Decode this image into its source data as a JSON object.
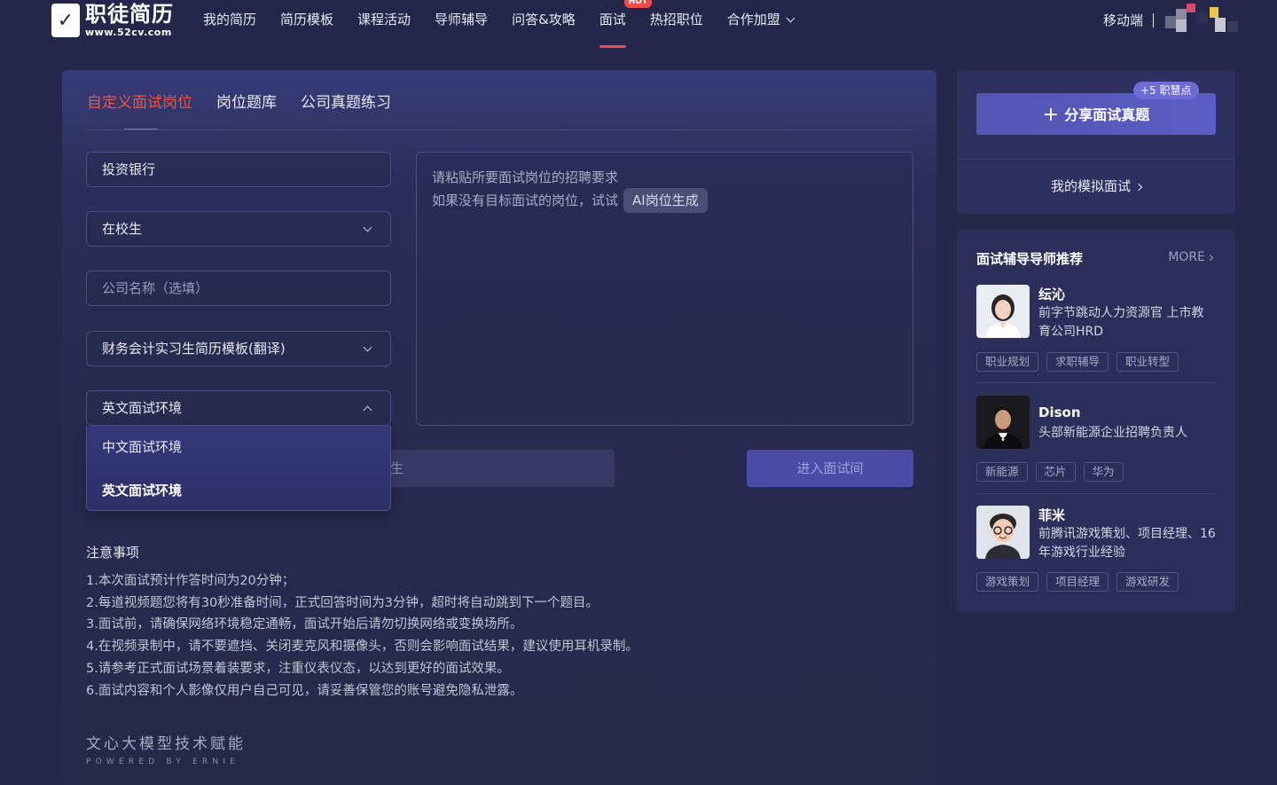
{
  "logo": {
    "cn": "职徒简历",
    "url": "www.52cv.com"
  },
  "nav": {
    "items": [
      {
        "label": "我的简历"
      },
      {
        "label": "简历模板"
      },
      {
        "label": "课程活动"
      },
      {
        "label": "导师辅导"
      },
      {
        "label": "问答&攻略"
      },
      {
        "label": "面试",
        "badge": "HOT"
      },
      {
        "label": "热招职位"
      },
      {
        "label": "合作加盟"
      }
    ],
    "mobile": "移动端"
  },
  "tabs": [
    "自定义面试岗位",
    "岗位题库",
    "公司真题练习"
  ],
  "form": {
    "position": "投资银行",
    "identity": "在校生",
    "company_placeholder": "公司名称（选填）",
    "resume": "财务会计实习生简历模板(翻译)",
    "environment": "英文面试环境",
    "environment_options": [
      "中文面试环境",
      "英文面试环境"
    ],
    "jd_line1": "请粘贴所要面试岗位的招聘要求",
    "jd_line2": "如果没有目标面试的岗位，试试",
    "ai_chip": "AI岗位生成",
    "hidden_fragment": "生",
    "enter_button": "进入面试间"
  },
  "notes": {
    "title": "注意事项",
    "items": [
      "1.本次面试预计作答时间为20分钟；",
      "2.每道视频题您将有30秒准备时间，正式回答时间为3分钟，超时将自动跳到下一个题目。",
      "3.面试前，请确保网络环境稳定通畅，面试开始后请勿切换网络或变换场所。",
      "4.在视频录制中，请不要遮挡、关闭麦克风和摄像头，否则会影响面试结果，建议使用耳机录制。",
      "5.请参考正式面试场景着装要求，注重仪表仪态，以达到更好的面试效果。",
      "6.面试内容和个人影像仅用户自己可见，请妥善保管您的账号避免隐私泄露。"
    ]
  },
  "powered": {
    "cn": "文心大模型技术赋能",
    "en": "POWERED BY ERNIE"
  },
  "share": {
    "button": "分享面试真题",
    "badge": "+5 职慧点",
    "mock_link": "我的模拟面试"
  },
  "mentors": {
    "title": "面试辅导导师推荐",
    "more": "MORE",
    "list": [
      {
        "name": "纭沁",
        "desc": "前字节跳动人力资源官 上市教育公司HRD",
        "tags": [
          "职业规划",
          "求职辅导",
          "职业转型"
        ]
      },
      {
        "name": "Dison",
        "desc": "头部新能源企业招聘负责人",
        "tags": [
          "新能源",
          "芯片",
          "华为"
        ]
      },
      {
        "name": "菲米",
        "desc": "前腾讯游戏策划、项目经理、16年游戏行业经验",
        "tags": [
          "游戏策划",
          "项目经理",
          "游戏研发"
        ]
      }
    ]
  },
  "colors": {
    "accent": "#f2523e",
    "primary": "#5456b4",
    "background": "#25284a"
  }
}
